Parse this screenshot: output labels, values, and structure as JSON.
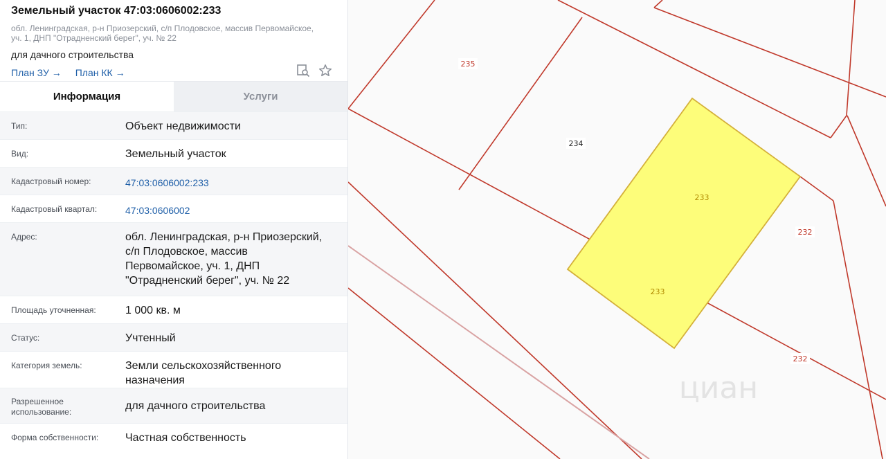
{
  "header": {
    "title": "Земельный участок 47:03:0606002:233",
    "address_line1": "обл. Ленинградская, р-н Приозерский, с/п Плодовское, массив Первомайское,",
    "address_line2": "уч. 1, ДНП \"Отрадненский берег\", уч. № 22",
    "usage": "для дачного строительства",
    "link_plan_zu": "План ЗУ →",
    "link_plan_kk": "План КК →",
    "icons": [
      "search-document-icon",
      "star-icon"
    ]
  },
  "tabs": [
    {
      "label": "Информация",
      "active": true
    },
    {
      "label": "Услуги",
      "active": false
    }
  ],
  "info": [
    {
      "key": "Тип:",
      "value": "Объект недвижимости"
    },
    {
      "key": "Вид:",
      "value": "Земельный участок"
    },
    {
      "key": "Кадастровый номер:",
      "value": "47:03:0606002:233"
    },
    {
      "key": "Кадастровый квартал:",
      "value": "47:03:0606002"
    },
    {
      "key": "Адрес:",
      "value_lines": [
        "обл. Ленинградская, р-н Приозерский,",
        "с/п Плодовское, массив",
        "Первомайское, уч. 1, ДНП",
        "\"Отрадненский берег\", уч. № 22"
      ]
    },
    {
      "key": "Площадь уточненная:",
      "value": "1 000 кв. м"
    },
    {
      "key": "Статус:",
      "value": "Учтенный"
    },
    {
      "key": "Категория земель:",
      "value_lines": [
        "Земли сельскохозяйственного",
        "назначения"
      ]
    },
    {
      "key_lines": [
        "Разрешенное",
        "использование:"
      ],
      "value": "для дачного строительства"
    },
    {
      "key": "Форма собственности:",
      "value": "Частная собственность"
    }
  ],
  "map": {
    "labels": [
      "235",
      "234",
      "233",
      "233",
      "232",
      "232"
    ],
    "watermark": "циан",
    "colors": {
      "boundary": "#c0392b",
      "highlight_fill": "#fdfd7a",
      "highlight_stroke": "#d4b03a",
      "label_red": "#c0392b",
      "label_yellow": "#b08a00"
    }
  }
}
